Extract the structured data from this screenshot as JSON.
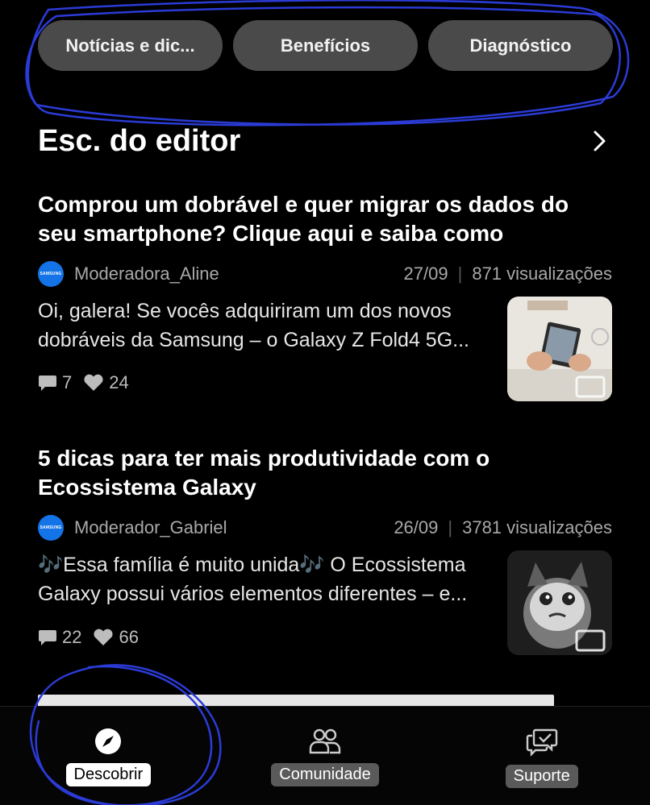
{
  "chips": [
    "Notícias e dic...",
    "Benefícios",
    "Diagnóstico"
  ],
  "section": {
    "title": "Esc. do editor"
  },
  "posts": [
    {
      "title_line1": "Comprou um dobrável e quer migrar os dados do",
      "title_line2": "seu smartphone? Clique aqui e saiba como",
      "author": "Moderadora_Aline",
      "date": "27/09",
      "views": "871 visualizações",
      "excerpt_line1": "Oi, galera! Se vocês adquiriram um dos novos",
      "excerpt_line2": "dobráveis da Samsung – o Galaxy Z Fold4 5G...",
      "comments": "7",
      "likes": "24"
    },
    {
      "title_line1": "5 dicas para ter mais produtividade com o",
      "title_line2": "Ecossistema Galaxy",
      "author": "Moderador_Gabriel",
      "date": "26/09",
      "views": "3781 visualizações",
      "excerpt_line1": "🎶Essa família é muito unida🎶 O Ecossistema",
      "excerpt_line2": "Galaxy possui vários elementos diferentes – e...",
      "comments": "22",
      "likes": "66"
    }
  ],
  "avatar_text": "SAMSUNG",
  "nav": {
    "discover": "Descobrir",
    "community": "Comunidade",
    "support": "Suporte"
  },
  "colors": {
    "background": "#000000",
    "chip": "#4a4a4a",
    "avatar": "#1473e6",
    "annotation": "#2b3bd6"
  }
}
